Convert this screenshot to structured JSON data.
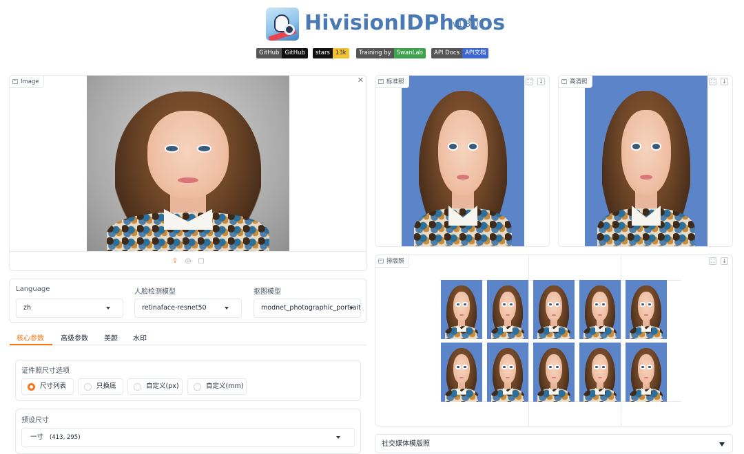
{
  "header": {
    "title": "HivisionIDPhotos",
    "version": "v1.3.0",
    "badges": [
      {
        "left": "GitHub",
        "right": "GitHub"
      },
      {
        "left": "stars",
        "right": "13k"
      },
      {
        "left": "Training by",
        "right": "SwanLab"
      },
      {
        "left": "API Docs",
        "right": "API文档"
      }
    ]
  },
  "input_panel": {
    "label": "Image",
    "close_glyph": "✕"
  },
  "upload_icons": [
    "upload-icon",
    "webcam-icon",
    "clipboard-icon"
  ],
  "outputs": {
    "standard": {
      "label": "标准照"
    },
    "hd": {
      "label": "高清照"
    },
    "layout": {
      "label": "排版照"
    }
  },
  "selectors": {
    "language": {
      "label": "Language",
      "value": "zh"
    },
    "face_model": {
      "label": "人脸检测模型",
      "value": "retinaface-resnet50"
    },
    "matting_model": {
      "label": "抠图模型",
      "value": "modnet_photographic_portrait"
    }
  },
  "tabs": [
    "核心参数",
    "高级参数",
    "美颜",
    "水印"
  ],
  "size_options": {
    "label": "证件照尺寸选项",
    "options": [
      "尺寸列表",
      "只换底",
      "自定义(px)",
      "自定义(mm)"
    ],
    "selected": "尺寸列表"
  },
  "preset": {
    "label": "预设尺寸",
    "value": "一寸",
    "dims": "(413, 295)"
  },
  "social": {
    "label": "社交媒体模版照"
  },
  "colors": {
    "accent": "#f97316",
    "title": "#4a79b4",
    "photo_bg": "#5b84c9"
  }
}
